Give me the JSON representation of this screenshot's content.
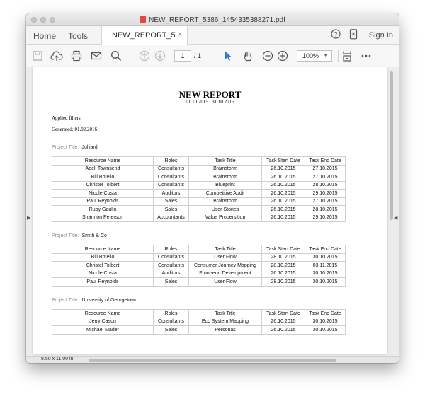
{
  "window": {
    "title": "NEW_REPORT_5386_1454335388271.pdf"
  },
  "tabbar": {
    "home": "Home",
    "tools": "Tools",
    "doc_tab": "NEW_REPORT_5...",
    "close": "×",
    "sign_in": "Sign In"
  },
  "toolbar": {
    "page_current": "1",
    "page_total": "/ 1",
    "zoom": "100%",
    "zoom_caret": "▼",
    "icons": [
      "save-icon",
      "upload-icon",
      "print-icon",
      "email-icon",
      "search-icon",
      "prev-page-icon",
      "next-page-icon",
      "select-cursor-icon",
      "hand-icon",
      "zoom-out-icon",
      "zoom-in-icon",
      "fit-page-icon",
      "more-icon",
      "help-icon",
      "mobile-icon"
    ]
  },
  "report": {
    "title": "NEW REPORT",
    "date_range": "01.10.2015...31.10.2015",
    "applied_filters": "Applied filters:",
    "generated": "Generated: 01.02.2016",
    "project_title_label": "Project Title:",
    "columns": [
      "Resource Name",
      "Roles",
      "Task Title",
      "Task Start Date",
      "Task End Date"
    ],
    "projects": [
      {
        "title": "Julliard",
        "rows": [
          [
            "Adeli Townsend",
            "Consultants",
            "Brainstorm",
            "26.10.2015",
            "27.10.2015"
          ],
          [
            "Bill Botello",
            "Consultants",
            "Brainstorm",
            "26.10.2015",
            "27.10.2015"
          ],
          [
            "Christel Tolbert",
            "Consultants",
            "Blueprint",
            "26.10.2015",
            "28.10.2015"
          ],
          [
            "Nicole Costa",
            "Auditors",
            "Competitive Audit",
            "26.10.2015",
            "29.10.2015"
          ],
          [
            "Paul Reynolds",
            "Sales",
            "Brainstorm",
            "26.10.2015",
            "27.10.2015"
          ],
          [
            "Ruby Gaulin",
            "Sales",
            "User Stories",
            "26.10.2015",
            "28.10.2015"
          ],
          [
            "Shannon Peterson",
            "Accountants",
            "Value Propersition",
            "26.10.2015",
            "29.10.2015"
          ]
        ]
      },
      {
        "title": "Smith & Co",
        "rows": [
          [
            "Bill Botello",
            "Consultants",
            "User Flow",
            "28.10.2015",
            "30.10.2015"
          ],
          [
            "Christel Tolbert",
            "Consultants",
            "Consumer Journey Mapping",
            "28.10.2015",
            "03.11.2015"
          ],
          [
            "Nicole Costa",
            "Auditors",
            "Front-end Development",
            "26.10.2015",
            "30.10.2015"
          ],
          [
            "Paul Reynolds",
            "Sales",
            "User Flow",
            "28.10.2015",
            "30.10.2015"
          ]
        ]
      },
      {
        "title": "University of Georgetown",
        "rows": [
          [
            "Jerry Cason",
            "Consultants",
            "Eco System Mapping",
            "26.10.2015",
            "30.10.2015"
          ],
          [
            "Michael Mader",
            "Sales",
            "Personas",
            "26.10.2015",
            "30.10.2015"
          ]
        ]
      }
    ]
  },
  "status": {
    "page_size": "8.50 x 11.00 in"
  },
  "colors": {
    "pdf_badge": "#e34a3b",
    "select_tool_active": "#2a7ad6"
  }
}
